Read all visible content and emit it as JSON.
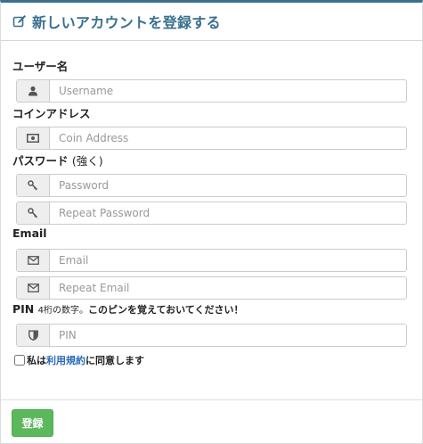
{
  "header": {
    "title": "新しいアカウントを登録する",
    "icon": "edit-icon"
  },
  "form": {
    "username": {
      "label": "ユーザー名",
      "placeholder": "Username",
      "icon": "user-icon"
    },
    "coin_address": {
      "label": "コインアドレス",
      "placeholder": "Coin Address",
      "icon": "money-icon"
    },
    "password": {
      "label": "パスワード",
      "label_note": "(強く)",
      "placeholder": "Password",
      "repeat_placeholder": "Repeat Password",
      "icon": "key-icon"
    },
    "email": {
      "label": "Email",
      "placeholder": "Email",
      "repeat_placeholder": "Repeat Email",
      "icon": "envelope-icon"
    },
    "pin": {
      "label": "PIN",
      "note": "4桁の数字。",
      "note_strong": "このピンを覚えておいてください！",
      "placeholder": "PIN",
      "icon": "shield-icon"
    },
    "terms": {
      "prefix": "私は",
      "link": "利用規約",
      "suffix": "に同意します"
    },
    "submit_label": "登録"
  },
  "colors": {
    "accent": "#3a6f8e",
    "button": "#5cb85c",
    "link": "#2a6ab7"
  }
}
